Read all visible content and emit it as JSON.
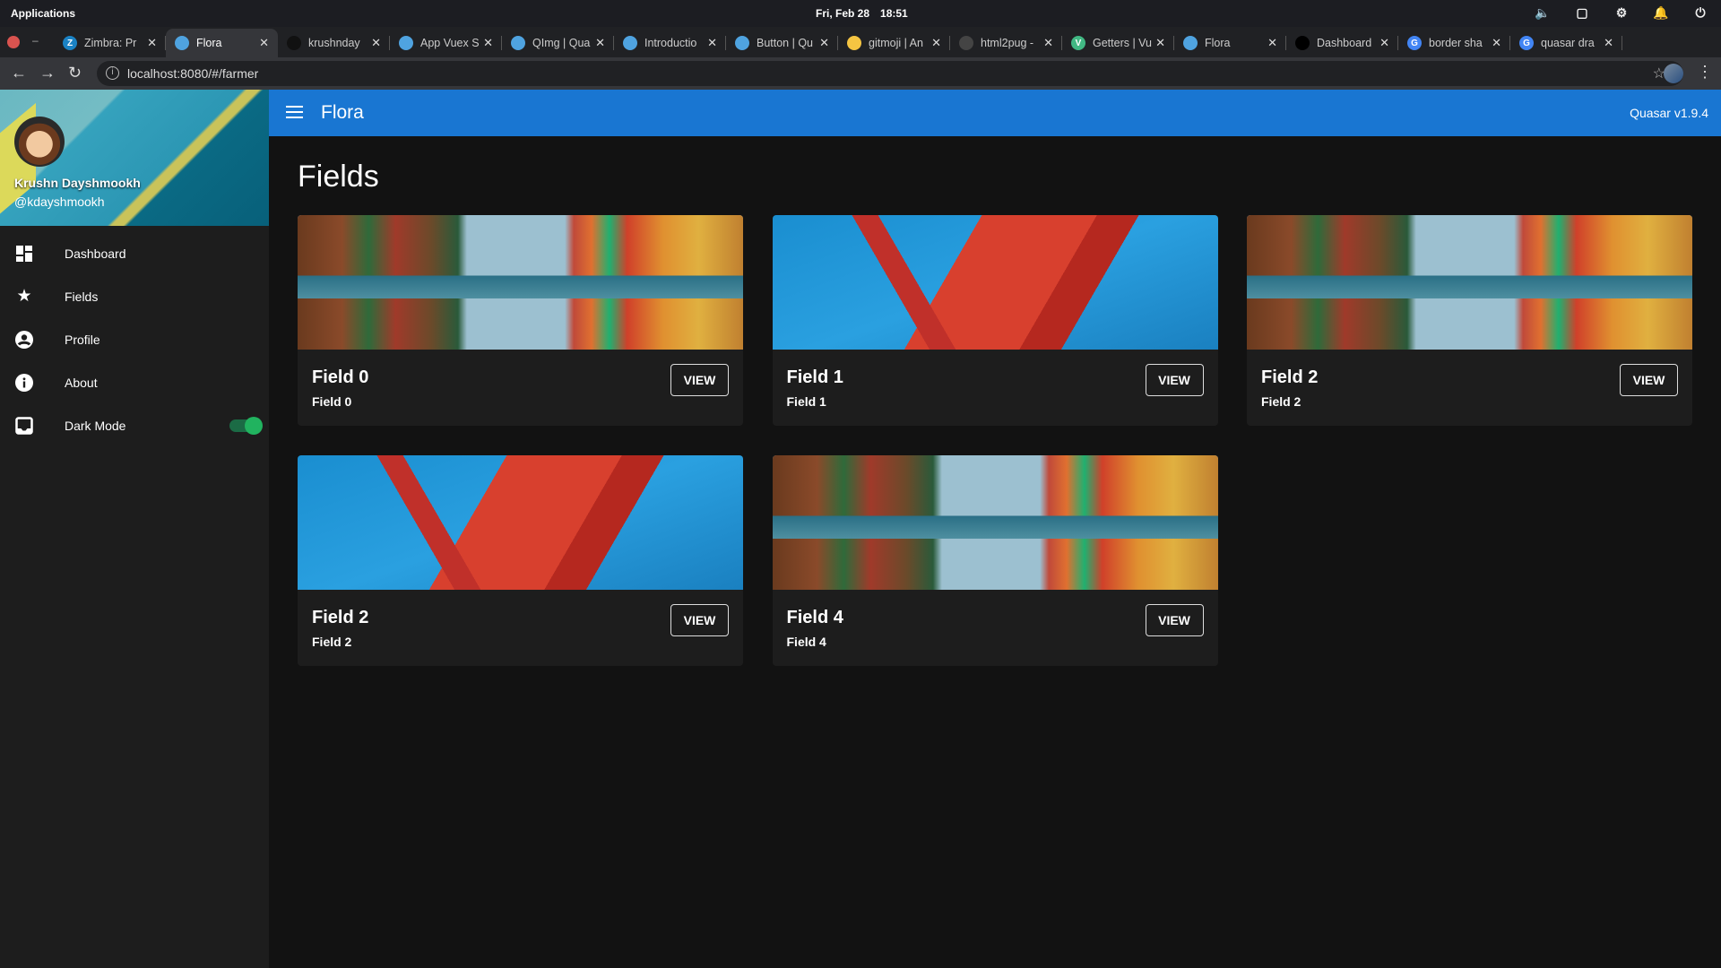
{
  "os": {
    "apps_label": "Applications",
    "date": "Fri, Feb 28",
    "time": "18:51"
  },
  "browser": {
    "tabs": [
      {
        "title": "Zimbra: Pr",
        "icon": "Z",
        "color": "#1a82c4"
      },
      {
        "title": "Flora",
        "icon": "quasar",
        "color": "#4fa3e0",
        "active": true
      },
      {
        "title": "krushnday",
        "icon": "github",
        "color": "#111"
      },
      {
        "title": "App Vuex S",
        "icon": "quasar",
        "color": "#4fa3e0"
      },
      {
        "title": "QImg | Qua",
        "icon": "quasar",
        "color": "#4fa3e0"
      },
      {
        "title": "Introductio",
        "icon": "quasar",
        "color": "#4fa3e0"
      },
      {
        "title": "Button | Qu",
        "icon": "quasar",
        "color": "#4fa3e0"
      },
      {
        "title": "gitmoji | An",
        "icon": "gitmoji",
        "color": "#f5c542"
      },
      {
        "title": "html2pug -",
        "icon": "html2pug",
        "color": "#444"
      },
      {
        "title": "Getters | Vu",
        "icon": "V",
        "color": "#41b883"
      },
      {
        "title": "Flora",
        "icon": "quasar",
        "color": "#4fa3e0"
      },
      {
        "title": "Dashboard",
        "icon": "triangle",
        "color": "#000"
      },
      {
        "title": "border sha",
        "icon": "G",
        "color": "#4285f4"
      },
      {
        "title": "quasar dra",
        "icon": "G",
        "color": "#4285f4"
      }
    ],
    "url": "localhost:8080/#/farmer"
  },
  "header": {
    "title": "Flora",
    "version": "Quasar v1.9.4"
  },
  "sidebar": {
    "user_name": "Krushn Dayshmookh",
    "user_handle": "@kdayshmookh",
    "items": [
      {
        "label": "Dashboard",
        "icon": "dashboard-icon"
      },
      {
        "label": "Fields",
        "icon": "star-icon"
      },
      {
        "label": "Profile",
        "icon": "account-circle-icon"
      },
      {
        "label": "About",
        "icon": "info-icon"
      },
      {
        "label": "Dark Mode",
        "icon": "inbox-icon"
      }
    ],
    "dark_mode_on": true
  },
  "main": {
    "title": "Fields",
    "cards": [
      {
        "title": "Field 0",
        "subtitle": "Field 0",
        "button": "VIEW",
        "image": "burano"
      },
      {
        "title": "Field 1",
        "subtitle": "Field 1",
        "button": "VIEW",
        "image": "bridge"
      },
      {
        "title": "Field 2",
        "subtitle": "Field 2",
        "button": "VIEW",
        "image": "burano"
      },
      {
        "title": "Field 2",
        "subtitle": "Field 2",
        "button": "VIEW",
        "image": "bridge"
      },
      {
        "title": "Field 4",
        "subtitle": "Field 4",
        "button": "VIEW",
        "image": "burano"
      }
    ]
  }
}
